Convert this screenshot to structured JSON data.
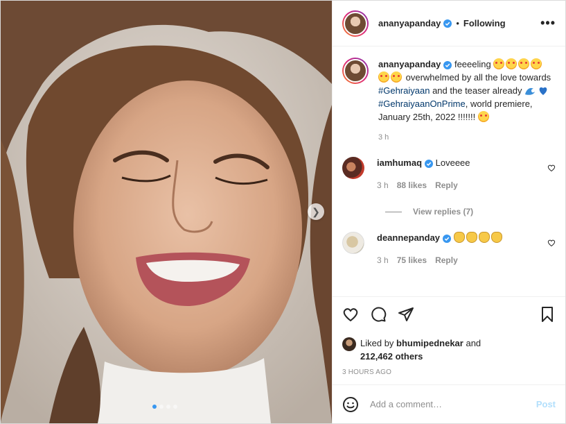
{
  "post": {
    "username": "ananyapanday",
    "separator": "•",
    "follow_status": "Following",
    "more": "•••",
    "media": {
      "dots_total": 4,
      "active_dot": 0
    }
  },
  "caption": {
    "username": "ananyapanday",
    "part1": "feeeeling",
    "part2": "overwhelmed by all the love towards",
    "hashtag1": "#Gehraiyaan",
    "part3": "and the teaser already",
    "hashtag2": "#GehraiyaanOnPrime",
    "part4": ", world premiere, January 25th, 2022 !!!!!!!",
    "time": "3 h"
  },
  "comments": [
    {
      "username": "iamhumaq",
      "text": "Loveeee",
      "time": "3 h",
      "likes": "88 likes",
      "reply": "Reply"
    },
    {
      "username": "deannepanday",
      "text": "",
      "time": "3 h",
      "likes": "75 likes",
      "reply": "Reply"
    }
  ],
  "view_replies": "View replies (7)",
  "liked_by": {
    "prefix": "Liked by",
    "user": "bhumipednekar",
    "and": "and",
    "others": "212,462 others"
  },
  "timestamp": "3 HOURS AGO",
  "add_comment": {
    "placeholder": "Add a comment…",
    "post_label": "Post"
  },
  "icons": [
    "verified-icon",
    "heart-icon",
    "comment-icon",
    "share-icon",
    "bookmark-icon",
    "emoji-icon",
    "chevron-right-icon"
  ]
}
